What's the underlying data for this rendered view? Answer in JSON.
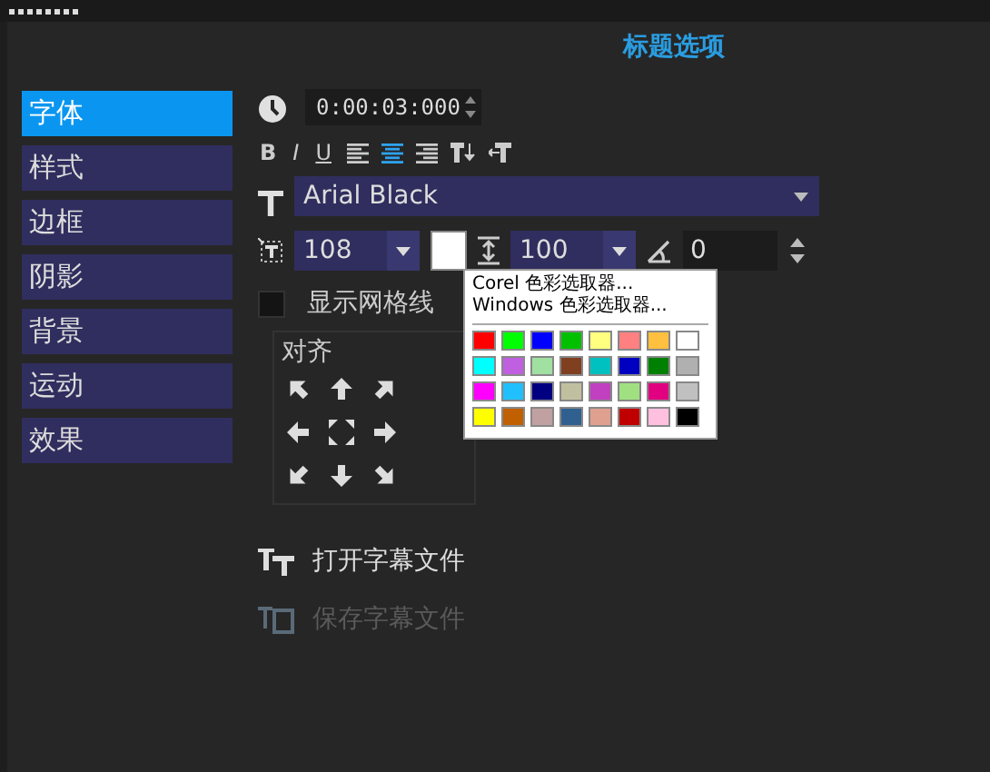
{
  "title": "标题选项",
  "sidebar": {
    "items": [
      {
        "label": "字体",
        "selected": true
      },
      {
        "label": "样式",
        "selected": false
      },
      {
        "label": "边框",
        "selected": false
      },
      {
        "label": "阴影",
        "selected": false
      },
      {
        "label": "背景",
        "selected": false
      },
      {
        "label": "运动",
        "selected": false
      },
      {
        "label": "效果",
        "selected": false
      }
    ]
  },
  "timecode": "0:00:03:000",
  "format_toolbar": [
    {
      "kind": "bold",
      "label": "B"
    },
    {
      "kind": "italic",
      "label": "I"
    },
    {
      "kind": "underline",
      "label": "U"
    },
    {
      "kind": "align-left",
      "selected": false
    },
    {
      "kind": "align-center",
      "selected": true
    },
    {
      "kind": "align-right",
      "selected": false
    },
    {
      "kind": "vertical-text"
    },
    {
      "kind": "flip-text"
    }
  ],
  "font": "Arial Black",
  "size": "108",
  "line_spacing": "100",
  "rotation": "0",
  "show_grid": {
    "label": "显示网格线",
    "checked": false
  },
  "alignment": {
    "label": "对齐"
  },
  "files": [
    {
      "label": "打开字幕文件",
      "disabled": false
    },
    {
      "label": "保存字幕文件",
      "disabled": true
    }
  ],
  "color_menu": {
    "items": [
      "Corel 色彩选取器...",
      "Windows 色彩选取器..."
    ],
    "swatches": [
      {
        "color": "#ff0000"
      },
      {
        "color": "#00ff00"
      },
      {
        "color": "#0000ff"
      },
      {
        "color": "#00c000"
      },
      {
        "color": "#ffff80"
      },
      {
        "color": "#ff8080"
      },
      {
        "color": "#ffc040"
      },
      {
        "color": "#ffffff"
      },
      {
        "color": "#00ffff"
      },
      {
        "color": "#c060e0"
      },
      {
        "color": "#a0e0a0"
      },
      {
        "color": "#804020"
      },
      {
        "color": "#00c0c0"
      },
      {
        "color": "#0000c0"
      },
      {
        "color": "#008000"
      },
      {
        "color": "#b0b0b0"
      },
      {
        "color": "#ff00ff"
      },
      {
        "color": "#20c0ff"
      },
      {
        "color": "#000080"
      },
      {
        "color": "#c0c0a0"
      },
      {
        "color": "#c040c0"
      },
      {
        "color": "#a0e080"
      },
      {
        "color": "#e00080"
      },
      {
        "color": "#c0c0c0"
      },
      {
        "color": "#ffff00"
      },
      {
        "color": "#c06000"
      },
      {
        "color": "#c0a0a0"
      },
      {
        "color": "#306090"
      },
      {
        "color": "#e0a090"
      },
      {
        "color": "#c00000"
      },
      {
        "color": "#ffc0e0"
      },
      {
        "color": "#000000"
      }
    ]
  }
}
